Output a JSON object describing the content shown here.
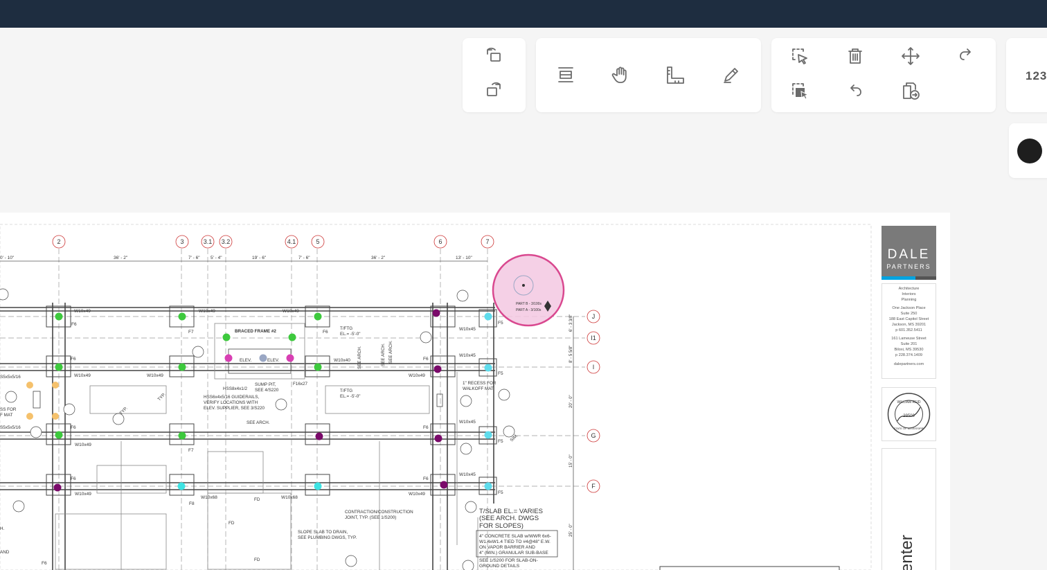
{
  "app": {
    "brand_color": "#1e2d40",
    "background": "#f5f5f5"
  },
  "toolbar": {
    "rotate": [
      "rotate-left",
      "rotate-right"
    ],
    "tools": [
      "split-view",
      "pan-hand",
      "measure-ruler",
      "pen-markup"
    ],
    "edit": [
      "select-area",
      "delete",
      "move",
      "redo",
      "select-copy",
      "undo",
      "copy-to-sheet"
    ],
    "counter_label": "123",
    "color": "#1e1e1e"
  },
  "title_block": {
    "firm_name": "DALE",
    "firm_sub": "PARTNERS",
    "services": [
      "Architecture",
      "Interiors",
      "Planning"
    ],
    "office1": [
      "One Jackson Place",
      "Suite 250",
      "188 East Capitol Street",
      "Jackson, MS 39201",
      "p 601.352.5411"
    ],
    "office2": [
      "161 Lameuse Street",
      "Suite 201",
      "Biloxi, MS 39530",
      "p 228.374.1409"
    ],
    "website": "dalepartners.com",
    "seal_text": "WILLIAM REID",
    "seal_number": "29500",
    "seal_state": "STATE OF MISSISSIPPI",
    "sheet_title_partial": "enter"
  },
  "plan": {
    "grid_top": [
      "2",
      "3",
      "3.1",
      "3.2",
      "4.1",
      "5",
      "6",
      "7"
    ],
    "grid_side": [
      "J",
      "I1",
      "I",
      "G",
      "F"
    ],
    "dims_top": [
      "0' - 10\"",
      "36' - 2\"",
      "7' - 6\"",
      "5' - 4\"",
      "19' - 6\"",
      "7' - 6\"",
      "36' - 2\"",
      "13' - 10\""
    ],
    "dims_side": [
      "6' - 3 3/8\"",
      "8' - 5 5/8\"",
      "20' - 0\"",
      "15' - 0\"",
      "25' - 0\""
    ],
    "beams": [
      "W10x49",
      "W10x49",
      "W10x49",
      "W10x45",
      "W10x49",
      "W10x49",
      "W10x40",
      "W10x45",
      "W10x49",
      "W10x49",
      "W10x45",
      "W10x68",
      "W10x68",
      "W10x49",
      "W10x45",
      "W10x49"
    ],
    "footings": [
      "F6",
      "F7",
      "F6",
      "F5",
      "F6",
      "F6",
      "F5",
      "F6",
      "F7",
      "F6",
      "F5",
      "F6",
      "F6",
      "F8",
      "F5",
      "F6"
    ],
    "notes": {
      "braced_frame": "BRACED FRAME #2",
      "elev1": "ELEV.",
      "elev2": "ELEV.",
      "tftg1": "T/FTG",
      "tftg1_el": "EL.= -5'-0\"",
      "tftg2": "T/FTG",
      "tftg2_el": "EL.= -5'-0\"",
      "sump": "SUMP PIT,",
      "sump_see": "SEE 4/S220",
      "hss1": "HSS8x4x1/2",
      "guide1": "HSS6x4x5/16 GUIDERAILS,",
      "guide2": "VERIFY LOCATIONS WITH",
      "guide3": "ELEV. SUPPLIER, SEE 3/S220",
      "see_arch": "SEE ARCH.",
      "see_arch_v1": "SEE ARCH.",
      "see_arch_v2": "SEE ARCH.",
      "see_arch_v3": "SEE ARCH.",
      "recess1": "1\" RECESS FOR",
      "recess2": "WALKOFF MAT",
      "f16": "F16x27",
      "joint1": "CONTRACTION/CONSTRUCTION",
      "joint2": "JOINT, TYP. (SEE 1/S200)",
      "slope1": "SLOPE SLAB TO DRAIN,",
      "slope2": "SEE PLUMBING DWGS, TYP.",
      "slab_el1": "T/SLAB EL.= VARIES",
      "slab_el2": "(SEE ARCH. DWGS",
      "slab_el3": "FOR SLOPES)",
      "conc1": "4\" CONCRETE SLAB w/WWR 6x6-",
      "conc2": "W1.4xW1.4 TIED TO #4@48\" E.W.",
      "conc3": "ON VAPOR BARRIER AND",
      "conc4": "4\" (MIN.) GRANULAR SUB-BASE",
      "see_slab1": "SEE 1/S200 FOR SLAB-ON-",
      "see_slab2": "GROUND DETAILS",
      "left1": "S5x5x5/16",
      "left2": "SS FOR",
      "left3": "F MAT",
      "left4": "S5x5x5/16",
      "left5": "H.",
      "left6": "AND",
      "fd1": "FD",
      "fd2": "FD",
      "fd3": "FD",
      "typ1": "TYP.",
      "typ2": "TYP.",
      "sim": "SIM."
    },
    "marker_part_b": "PART B - 3/100s",
    "marker_part_a": "PART A - 3/100s"
  }
}
